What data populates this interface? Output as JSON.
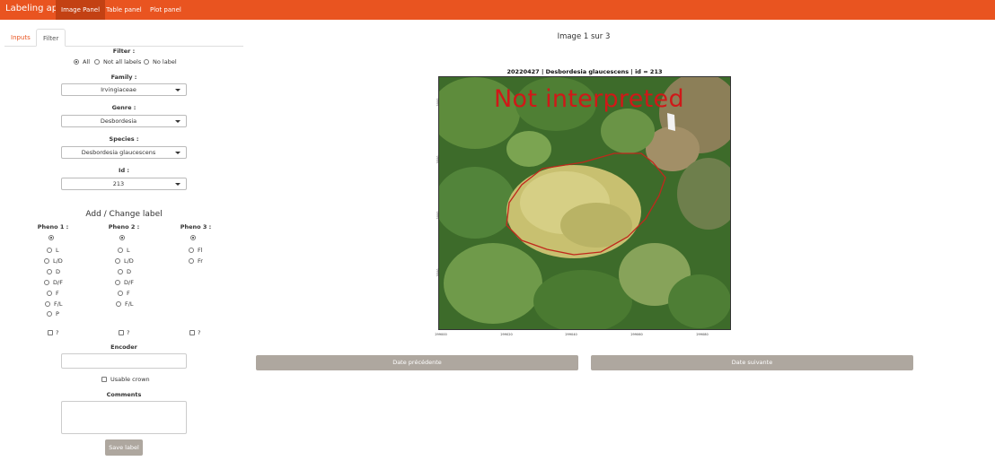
{
  "app": {
    "brand": "Labeling app"
  },
  "nav": {
    "items": [
      {
        "label": "Image Panel",
        "active": true
      },
      {
        "label": "Table panel",
        "active": false
      },
      {
        "label": "Plot panel",
        "active": false
      }
    ]
  },
  "tabs": [
    {
      "label": "Inputs",
      "active": false
    },
    {
      "label": "Filter",
      "active": true
    }
  ],
  "filter": {
    "title": "Filter :",
    "options": [
      "All",
      "Not all labels",
      "No label"
    ],
    "selected": "All",
    "family_label": "Family :",
    "family_value": "Irvingiaceae",
    "genre_label": "Genre :",
    "genre_value": "Desbordesia",
    "species_label": "Species :",
    "species_value": "Desbordesia glaucescens",
    "id_label": "Id :",
    "id_value": "213"
  },
  "label_section": {
    "title": "Add / Change label",
    "pheno1": {
      "label": "Pheno 1 :",
      "options": [
        "L",
        "L/D",
        "D",
        "D/F",
        "F",
        "F/L",
        "P"
      ],
      "unsure": "?"
    },
    "pheno2": {
      "label": "Pheno 2 :",
      "options": [
        "L",
        "L/D",
        "D",
        "D/F",
        "F",
        "F/L"
      ],
      "unsure": "?"
    },
    "pheno3": {
      "label": "Pheno 3 :",
      "options": [
        "Fl",
        "Fr"
      ],
      "unsure": "?"
    },
    "encoder_label": "Encoder",
    "encoder_value": "",
    "usable_crown_label": "Usable crown",
    "usable_crown_checked": false,
    "comments_label": "Comments",
    "comments_value": "",
    "save_label": "Save label"
  },
  "image_panel": {
    "heading": "Image 1 sur 3",
    "plot_title": "20220427 | Desbordesia glaucescens | id = 213",
    "stamp": "Not interpreted",
    "y_ticks": [
      "3000",
      "3500",
      "3000",
      "3500"
    ],
    "x_ticks": [
      "299000",
      "299020",
      "299040",
      "299060",
      "299080"
    ],
    "prev_label": "Date précédente",
    "next_label": "Date suivante"
  },
  "colors": {
    "navbar": "#e95420",
    "navbar_active": "#c34113",
    "button": "#aea79f",
    "stamp": "#d01818",
    "crown_outline": "#c0281c"
  }
}
